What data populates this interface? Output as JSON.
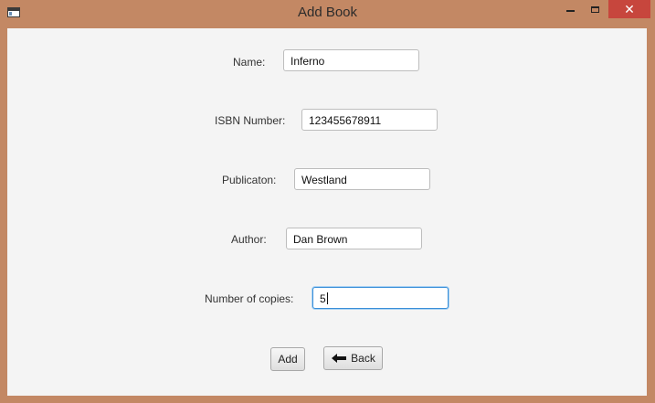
{
  "window": {
    "title": "Add Book",
    "close_glyph": "✕",
    "icons": {
      "app": "app-window-icon",
      "minimize": "minimize-icon",
      "maximize": "maximize-icon",
      "close": "close-icon"
    }
  },
  "form": {
    "name": {
      "label": "Name:",
      "value": "Inferno"
    },
    "isbn": {
      "label": "ISBN Number:",
      "value": "123455678911"
    },
    "publication": {
      "label": "Publicaton:",
      "value": "Westland"
    },
    "author": {
      "label": "Author:",
      "value": "Dan Brown"
    },
    "copies": {
      "label": "Number of copies:",
      "value": "5"
    }
  },
  "buttons": {
    "add_label": "Add",
    "back_label": "Back",
    "back_icon": "arrow-left-icon"
  },
  "colors": {
    "frame": "#c38864",
    "close_button": "#c7463d",
    "focus_border": "#3a8fd8"
  }
}
